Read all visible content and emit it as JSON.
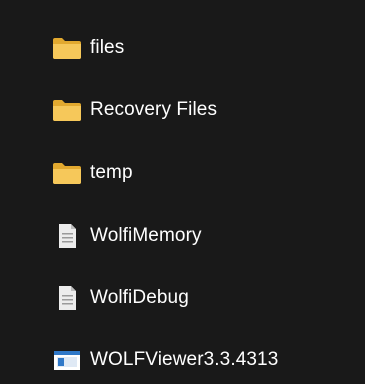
{
  "items": [
    {
      "label": "files",
      "type": "folder",
      "icon": "folder-icon"
    },
    {
      "label": "Recovery Files",
      "type": "folder",
      "icon": "folder-icon"
    },
    {
      "label": "temp",
      "type": "folder",
      "icon": "folder-icon"
    },
    {
      "label": "WolfiMemory",
      "type": "file",
      "icon": "document-icon"
    },
    {
      "label": "WolfiDebug",
      "type": "file",
      "icon": "document-icon"
    },
    {
      "label": "WOLFViewer3.3.4313",
      "type": "application",
      "icon": "application-icon"
    }
  ],
  "colors": {
    "background": "#191919",
    "folder": "#f3c44e",
    "text": "#ffffff"
  }
}
